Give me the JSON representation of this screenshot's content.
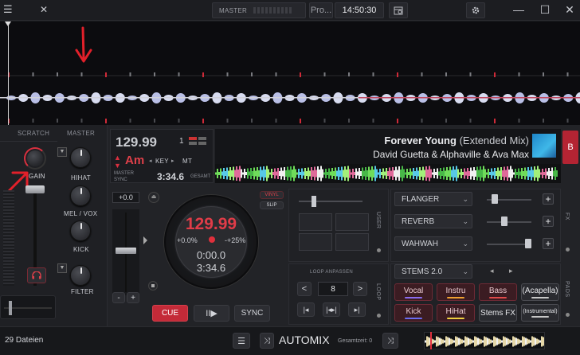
{
  "topbar": {
    "master_label": "MASTER",
    "pro_label": "Pro...",
    "clock": "14:50:30"
  },
  "mixer": {
    "scratch_label": "SCRATCH",
    "master_label": "MASTER",
    "gain_label": "GAIN",
    "hihat_label": "HIHAT",
    "mel_vox_label": "MEL / VOX",
    "kick_label": "KICK",
    "filter_label": "FILTER"
  },
  "deck": {
    "bpm": "129.99",
    "deck_number": "1",
    "key": "Am",
    "key_label": "KEY",
    "mt_label": "MT",
    "master_label": "MASTER",
    "sync_label": "SYNC",
    "total_time": "3:34.6",
    "gesamt_label": "GESAMT",
    "title": "Forever Young",
    "title_suffix": "(Extended Mix)",
    "artist": "David Guetta & Alphaville & Ava Max",
    "deck_letter": "B",
    "pitch_value": "+0.0",
    "vinyl_label": "VINYL",
    "slip_label": "SLIP",
    "jog_bpm": "129.99",
    "jog_pitch": "+0.0%",
    "jog_range": "-+25%",
    "jog_elapsed": "0:00.0",
    "jog_remaining": "3:34.6",
    "minus_label": "-",
    "plus_label": "+",
    "cue_label": "CUE",
    "play_label": "II▶",
    "sync_button_label": "SYNC",
    "accent_red": "#d9303f"
  },
  "fx": {
    "user_label": "USER",
    "fx_label": "FX",
    "slots": [
      {
        "name": "FLANGER",
        "level": 0.12
      },
      {
        "name": "REVERB",
        "level": 0.35
      },
      {
        "name": "WAHWAH",
        "level": 0.92
      }
    ],
    "add_label": "+"
  },
  "loop": {
    "title": "LOOP ANPASSEN",
    "value": "8",
    "prev": "<",
    "next": ">",
    "loop_tab": "LOOP"
  },
  "stems": {
    "preset": "STEMS 2.0",
    "pads_tab": "PADS",
    "pads": [
      {
        "label": "Vocal",
        "color": "#8b6cf0"
      },
      {
        "label": "Instru",
        "color": "#f0a030"
      },
      {
        "label": "Bass",
        "color": "#e04a4a"
      },
      {
        "label": "(Acapella)",
        "color": "#c8c8c8"
      },
      {
        "label": "Kick",
        "color": "#6a6cf0"
      },
      {
        "label": "HiHat",
        "color": "#f0d040"
      },
      {
        "label": "Stems FX",
        "color": ""
      },
      {
        "label": "(Instrumental)",
        "color": "#c8c8c8"
      }
    ]
  },
  "browser": {
    "file_count": "29 Dateien",
    "automix_label": "AUTOMIX",
    "gesamtzeit": "Gesamtzeit: 0"
  }
}
